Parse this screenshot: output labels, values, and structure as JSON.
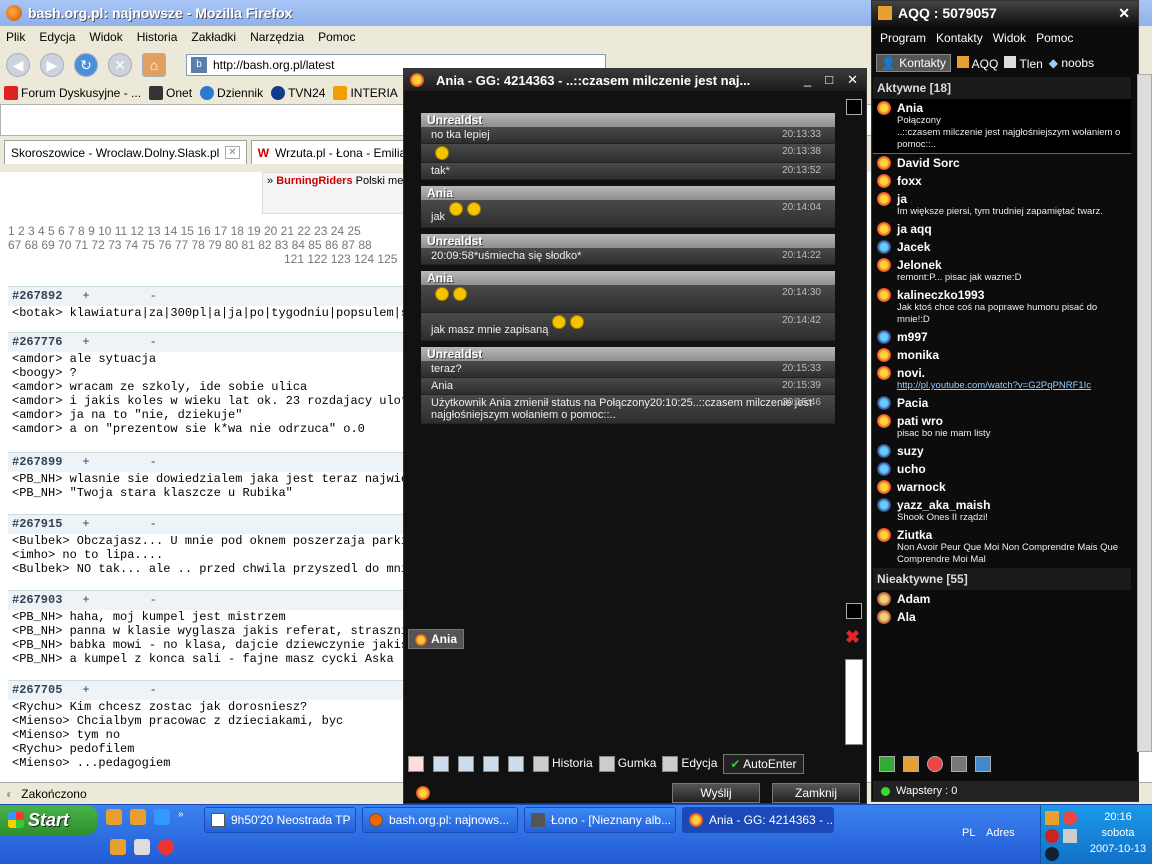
{
  "firefox": {
    "title": "bash.org.pl: najnowsze - Mozilla Firefox",
    "menu": [
      "Plik",
      "Edycja",
      "Widok",
      "Historia",
      "Zakładki",
      "Narzędzia",
      "Pomoc"
    ],
    "url": "http://bash.org.pl/latest",
    "bookmarks": [
      "Forum Dyskusyjne - ...",
      "Onet",
      "Dziennik",
      "TVN24",
      "INTERIA"
    ],
    "tabs": [
      "Skoroszowice - Wroclaw.Dolny.Slask.pl",
      "Wrzuta.pl - Łona - Emilia"
    ],
    "status": "Zakończono",
    "banner": {
      "brand": "BurningRiders",
      "text": " Polski me"
    },
    "pages_line1": "1 2 3 4 5 6 7 8 9 10 11 12 13 14 15 16 17 18 19 20 21 22 23 24 25",
    "pages_line2": "67 68 69 70 71 72 73 74 75 76 77 78 79 80 81 82 83 84 85 86 87 88",
    "pages_line3": "121 122 123 124 125",
    "quotes": [
      {
        "id": "#267892",
        "lines": [
          "<botak> klawiatura|za|300pl|a|ja|po|tygodniu|popsulem|sp"
        ]
      },
      {
        "id": "#267776",
        "lines": [
          "<amdor> ale sytuacja",
          "<boogy> ?",
          "<amdor> wracam ze szkoly, ide sobie ulica",
          "<amdor> i jakis koles w wieku lat ok. 23 rozdajacy ulotk",
          "<amdor> ja na to \"nie, dziekuje\"",
          "<amdor> a on \"prezentow sie k*wa nie odrzuca\" o.0"
        ]
      },
      {
        "id": "#267899",
        "lines": [
          "<PB_NH> wlasnie sie dowiedzialem jaka jest teraz najwiek",
          "<PB_NH> \"Twoja stara klaszcze u Rubika\""
        ]
      },
      {
        "id": "#267915",
        "lines": [
          "<Bulbek> Obczajasz... U mnie pod oknem poszerzaja parkin",
          "<imho> no to lipa....",
          "<Bulbek> NO tak... ale .. przed chwila przyszedl do mnie"
        ]
      },
      {
        "id": "#267903",
        "lines": [
          "<PB_NH> haha, moj kumpel jest mistrzem",
          "<PB_NH> panna w klasie wyglasza jakis referat, strasznie",
          "<PB_NH> babka mowi - no klasa, dajcie dziewczynie jakis",
          "<PB_NH> a kumpel z konca sali - fajne masz cycki Aska"
        ]
      },
      {
        "id": "#267705",
        "lines": [
          "<Rychu> Kim chcesz zostac jak dorosniesz?",
          "<Mienso> Chcialbym pracowac z dzieciakami, byc",
          "<Mienso> tym no",
          "<Rychu> pedofilem",
          "<Mienso> ...pedagogiem"
        ]
      }
    ]
  },
  "chat": {
    "title": "Ania - GG: 4214363 - ..::czasem milczenie jest naj...",
    "groups": [
      {
        "sender": "Unrealdst",
        "rows": [
          {
            "text": "no tka lepiej",
            "time": "20:13:33",
            "emo": 0
          },
          {
            "text": "",
            "time": "20:13:38",
            "emo": 1
          },
          {
            "text": "tak*",
            "time": "20:13:52",
            "emo": 0
          }
        ]
      },
      {
        "sender": "Ania",
        "rows": [
          {
            "text": "jak",
            "time": "20:14:04",
            "emo": 2
          }
        ]
      },
      {
        "sender": "Unrealdst",
        "rows": [
          {
            "text": "20:09:58*uśmiecha się słodko*",
            "time": "20:14:22",
            "emo": 0
          }
        ]
      },
      {
        "sender": "Ania",
        "rows": [
          {
            "text": "",
            "time": "20:14:30",
            "emo": 2
          },
          {
            "text": "jak masz mnie zapisaną",
            "time": "20:14:42",
            "emo": 2
          }
        ]
      },
      {
        "sender": "Unrealdst",
        "rows": [
          {
            "text": "teraz?",
            "time": "20:15:33",
            "emo": 0
          },
          {
            "text": "Ania",
            "time": "20:15:39",
            "emo": 0
          },
          {
            "text": "Użytkownik Ania zmienił status na Połączony20:10:25..::czasem milczenie jest najgłośniejszym wołaniem o pomoc::..",
            "time": "20:15:46",
            "emo": 0
          }
        ]
      }
    ],
    "contact_tag": "Ania",
    "tools": [
      "Historia",
      "Gumka",
      "Edycja",
      "AutoEnter"
    ],
    "send": "Wyślij",
    "close": "Zamknij"
  },
  "aqq": {
    "title": "AQQ : 5079057",
    "menu": [
      "Program",
      "Kontakty",
      "Widok",
      "Pomoc"
    ],
    "tabs": [
      "Kontakty",
      "AQQ",
      "Tlen",
      "noobs"
    ],
    "active_header": "Aktywne [18]",
    "inactive_header": "Nieaktywne [55]",
    "contacts": [
      {
        "name": "Ania",
        "status": "Połączony\n..::czasem milczenie jest najgłośniejszym wołaniem o pomoc::..",
        "icon": "sun",
        "sel": 1
      },
      {
        "name": "David Sorc",
        "status": "",
        "icon": "sun"
      },
      {
        "name": "foxx",
        "status": "",
        "icon": "sun"
      },
      {
        "name": "ja",
        "status": "Im większe piersi, tym trudniej zapamiętać twarz.",
        "icon": "sun"
      },
      {
        "name": "ja aqq",
        "status": "",
        "icon": "sun"
      },
      {
        "name": "Jacek",
        "status": "",
        "icon": "blue"
      },
      {
        "name": "Jelonek",
        "status": "remont:P... pisac jak wazne:D",
        "icon": "sun"
      },
      {
        "name": "kalineczko1993",
        "status": "Jak ktoś chce coś na poprawe humoru pisać do mnie!:D",
        "icon": "sun"
      },
      {
        "name": "m997",
        "status": "",
        "icon": "blue"
      },
      {
        "name": "monika",
        "status": "",
        "icon": "sun"
      },
      {
        "name": "novi.",
        "status": "http://pl.youtube.com/watch?v=G2PqPNRF1Ic",
        "icon": "sun",
        "link": 1
      },
      {
        "name": "Pacia",
        "status": "",
        "icon": "blue"
      },
      {
        "name": "pati wro",
        "status": "pisac bo nie mam listy",
        "icon": "sun"
      },
      {
        "name": "suzy",
        "status": "",
        "icon": "blue"
      },
      {
        "name": "ucho",
        "status": "",
        "icon": "blue"
      },
      {
        "name": "warnock",
        "status": "",
        "icon": "sun"
      },
      {
        "name": "yazz_aka_maish",
        "status": "Shook Ones II rządzi!",
        "icon": "blue"
      },
      {
        "name": "Ziutka",
        "status": "Non Avoir Peur Que Moi Non Comprendre Mais Que Comprendre Moi Mal",
        "icon": "sun"
      }
    ],
    "inactive": [
      "Adam",
      "Ala"
    ],
    "status_label": "Wapstery : 0"
  },
  "taskbar": {
    "start": "Start",
    "items": [
      "9h50'20 Neostrada TP",
      "bash.org.pl: najnows...",
      "Łono - [Nieznany alb...",
      "Ania - GG: 4214363 - ..."
    ],
    "lang": "PL",
    "adres": "Adres",
    "time": "20:16",
    "day": "sobota",
    "date": "2007-10-13"
  }
}
